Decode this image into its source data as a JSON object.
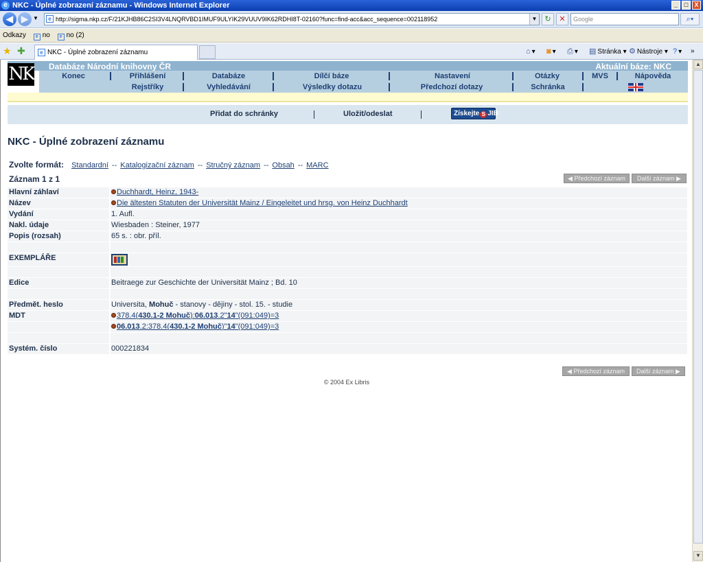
{
  "window": {
    "title": "NKC - Úplné zobrazení záznamu - Windows Internet Explorer",
    "min": "_",
    "max": "□",
    "close": "X"
  },
  "address": {
    "url": "http://sigma.nkp.cz/F/21KJHB86C2SI3V4LNQRVBD1IMUF9ULYIK29VUUV9IK62RDHI8T-02160?func=find-acc&acc_sequence=002118952",
    "search_placeholder": "Google"
  },
  "links": {
    "label": "Odkazy",
    "items": [
      "no",
      "no (2)"
    ]
  },
  "tab": {
    "title": "NKC - Úplné zobrazení záznamu"
  },
  "commands": {
    "page": "Stránka",
    "tools": "Nástroje"
  },
  "site": {
    "logo": "NK",
    "db_name": "Databáze Národní knihovny ČR",
    "current_db": "Aktuální báze:  NKC",
    "menu1": [
      "Konec",
      "Přihlášení",
      "Databáze",
      "Dílčí báze",
      "Nastavení",
      "Otázky",
      "MVS",
      "Nápověda"
    ],
    "menu2": [
      "Rejstříky",
      "Vyhledávání",
      "Výsledky dotazu",
      "Předchozí dotazy",
      "Schránka"
    ],
    "actions": [
      "Přidat do schránky",
      "Uložit/odeslat"
    ],
    "jib_label": "Získejte",
    "jib_suffix": "JIB"
  },
  "page": {
    "title": "NKC - Úplné zobrazení záznamu",
    "format_label": "Zvolte formát:",
    "formats": [
      "Standardní",
      "Katalogizační záznam",
      "Stručný záznam",
      "Obsah",
      "MARC"
    ],
    "record_count": "Záznam 1 z 1",
    "prev_record": "◀ Předchozí záznam",
    "next_record": "Další záznam ▶",
    "copyright": "© 2004 Ex Libris"
  },
  "record": {
    "hlavni_label": "Hlavní záhlaví",
    "hlavni_value": "Duchhardt, Heinz, 1943-",
    "nazev_label": "Název",
    "nazev_value": "Die ältesten Statuten der Universität Mainz / Eingeleitet und hrsg. von Heinz Duchhardt",
    "vydani_label": "Vydání",
    "vydani_value": "1. Aufl.",
    "nakl_label": "Nakl. údaje",
    "nakl_value": "Wiesbaden : Steiner, 1977",
    "popis_label": "Popis (rozsah)",
    "popis_value": "65 s. : obr. příl.",
    "exemplare_label": "EXEMPLÁŘE",
    "edice_label": "Edice",
    "edice_value": "Beitraege zur Geschichte der Universität Mainz ; Bd. 10",
    "predmet_label": "Předmět. heslo",
    "predmet_1": "Universita, ",
    "predmet_2": "Mohuč",
    "predmet_3": " - stanovy - dějiny - stol. 15. - studie",
    "mdt_label": "MDT",
    "mdt1_a": "378.4(",
    "mdt1_b": "430.1-2 Mohuč",
    "mdt1_c": "):",
    "mdt1_d": "06.013",
    "mdt1_e": ".2\"",
    "mdt1_f": "14",
    "mdt1_g": "\"(091:049)=3",
    "mdt2_a": "06.013",
    "mdt2_b": ".2:378.4(",
    "mdt2_c": "430.1-2 Mohuč",
    "mdt2_d": ")\"",
    "mdt2_e": "14",
    "mdt2_f": "\"(091:049)=3",
    "system_label": "Systém. číslo",
    "system_value": "000221834"
  }
}
